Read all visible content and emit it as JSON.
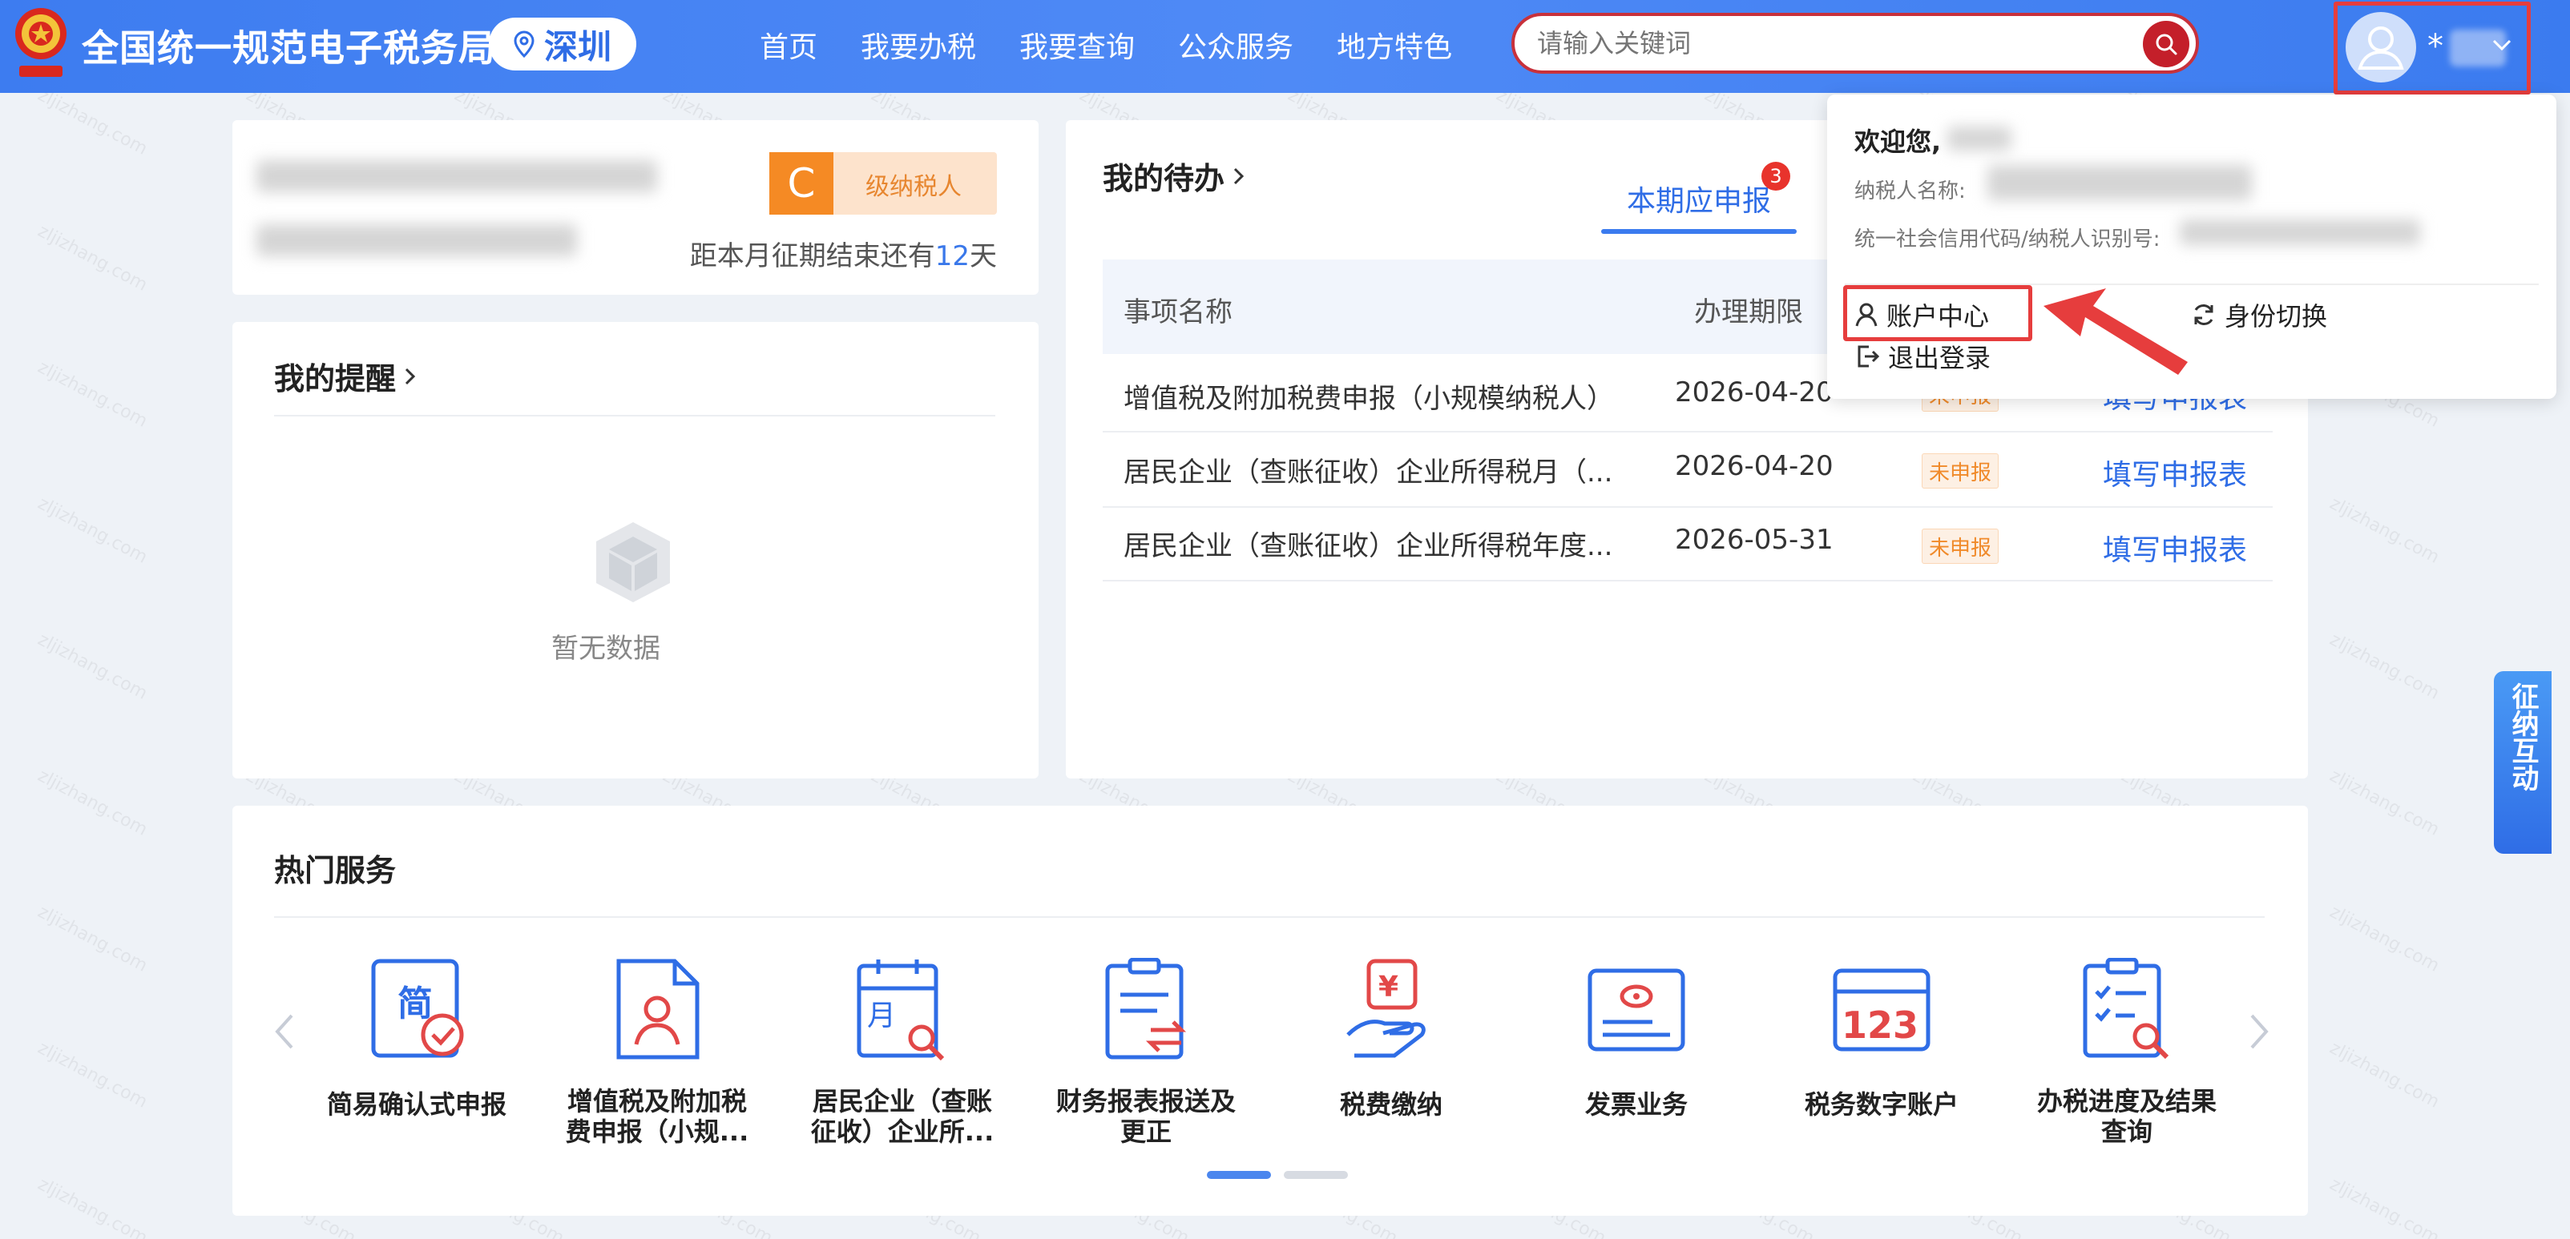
{
  "header": {
    "title": "全国统一规范电子税务局",
    "city": "深圳",
    "nav": [
      "首页",
      "我要办税",
      "我要查询",
      "公众服务",
      "地方特色"
    ],
    "search_placeholder": "请输入关键词",
    "user_name": "*"
  },
  "taxpayer": {
    "level_letter": "C",
    "level_text": "级纳税人",
    "deadline_prefix": "距本月征期结束还有",
    "deadline_days": "12",
    "deadline_suffix": "天"
  },
  "reminders": {
    "title": "我的提醒",
    "empty_text": "暂无数据"
  },
  "todo": {
    "title": "我的待办",
    "tab_active": "本期应申报",
    "tab_badge": "3",
    "headers": [
      "事项名称",
      "办理期限"
    ],
    "rows": [
      {
        "name": "增值税及附加税费申报（小规模纳税人）",
        "date": "2026-04-20",
        "status": "未申报",
        "action": "填写申报表"
      },
      {
        "name": "居民企业（查账征收）企业所得税月（...",
        "date": "2026-04-20",
        "status": "未申报",
        "action": "填写申报表"
      },
      {
        "name": "居民企业（查账征收）企业所得税年度...",
        "date": "2026-05-31",
        "status": "未申报",
        "action": "填写申报表"
      }
    ]
  },
  "hot_services": {
    "title": "热门服务",
    "items": [
      {
        "label": "简易确认式申报",
        "icon": "simple-declare-icon"
      },
      {
        "label": "增值税及附加税费申报（小规...",
        "icon": "vat-declare-icon"
      },
      {
        "label": "居民企业（查账征收）企业所...",
        "icon": "enterprise-tax-icon"
      },
      {
        "label": "财务报表报送及更正",
        "icon": "financial-report-icon"
      },
      {
        "label": "税费缴纳",
        "icon": "tax-payment-icon"
      },
      {
        "label": "发票业务",
        "icon": "invoice-icon"
      },
      {
        "label": "税务数字账户",
        "icon": "digital-account-icon"
      },
      {
        "label": "办税进度及结果查询",
        "icon": "progress-query-icon"
      }
    ]
  },
  "dropdown": {
    "welcome": "欢迎您,",
    "taxpayer_name_label": "纳税人名称:",
    "credit_code_label": "统一社会信用代码/纳税人识别号:",
    "account_center": "账户中心",
    "switch_identity": "身份切换",
    "logout": "退出登录"
  },
  "float_button": "征纳互动",
  "watermark": "zljizhang.com",
  "colors": {
    "header_blue": "#3d7cf0",
    "accent_blue": "#2f6de6",
    "search_red": "#c41f2a",
    "highlight_red": "#e63d3d",
    "status_orange": "#f08a2a"
  }
}
